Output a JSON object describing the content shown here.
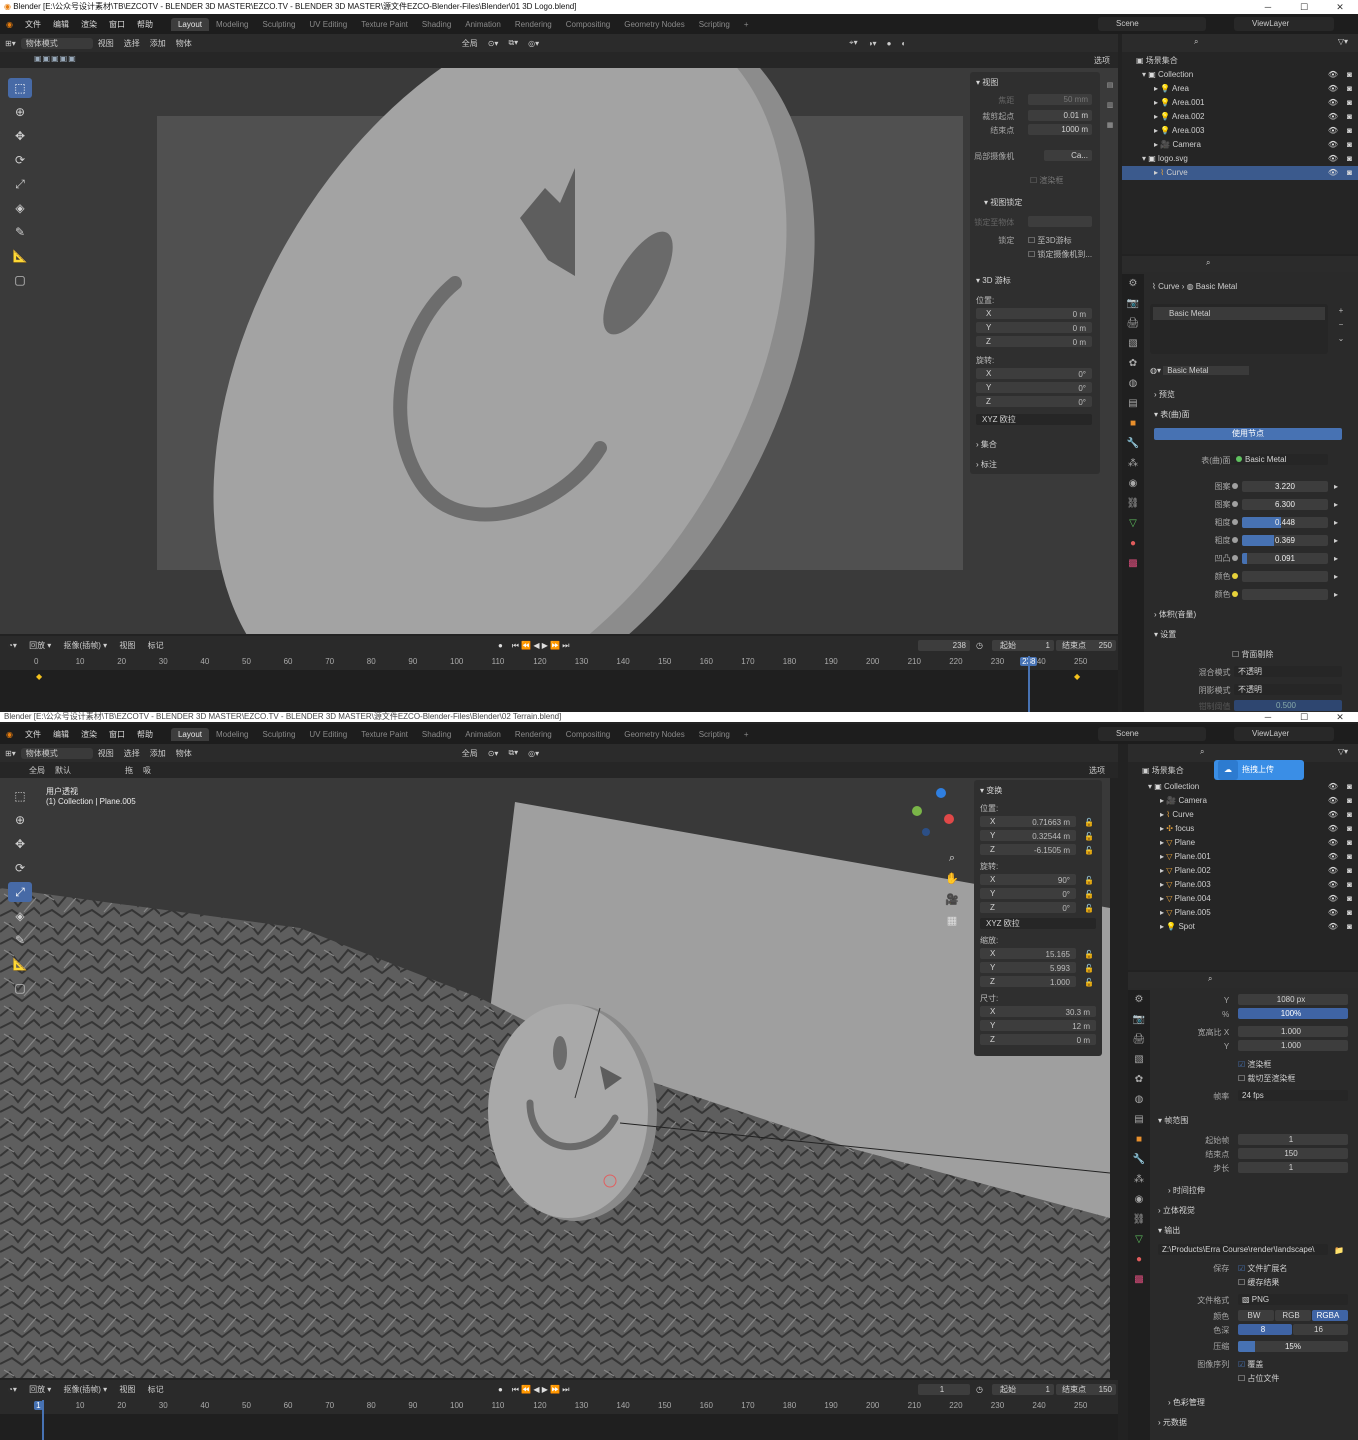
{
  "top": {
    "title": "Blender [E:\\公众号设计素材\\TB\\EZCOTV - BLENDER 3D MASTER\\EZCO.TV - BLENDER 3D MASTER\\源文件EZCO-Blender-Files\\Blender\\01 3D Logo.blend]",
    "menus": [
      "文件",
      "编辑",
      "渲染",
      "窗口",
      "帮助"
    ],
    "workspaces": [
      "Layout",
      "Modeling",
      "Sculpting",
      "UV Editing",
      "Texture Paint",
      "Shading",
      "Animation",
      "Rendering",
      "Compositing",
      "Geometry Nodes",
      "Scripting"
    ],
    "scene": "Scene",
    "view_layer": "ViewLayer",
    "mode": "物体模式",
    "view_menus": [
      "视图",
      "选择",
      "添加",
      "物体"
    ],
    "transform_orient": "全局",
    "options": "选项",
    "npanel": {
      "view_header": "视图",
      "focal_label": "焦距",
      "focal_value": "50 mm",
      "clip_start_label": "裁剪起点",
      "clip_start_value": "0.01 m",
      "clip_end_label": "结束点",
      "clip_end_value": "1000 m",
      "local_cam_label": "局部摄像机",
      "local_cam_value": "Ca...",
      "render_region": "渲染框",
      "view_lock_header": "视图锁定",
      "lock_obj_label": "锁定至物体",
      "lock_label": "锁定",
      "lock_3dcursor": "至3D游标",
      "lock_camera": "锁定摄像机到...",
      "cursor_header": "3D 游标",
      "location_label": "位置:",
      "loc": [
        {
          "axis": "X",
          "value": "0 m"
        },
        {
          "axis": "Y",
          "value": "0 m"
        },
        {
          "axis": "Z",
          "value": "0 m"
        }
      ],
      "rotation_label": "旋转:",
      "rot": [
        {
          "axis": "X",
          "value": "0°"
        },
        {
          "axis": "Y",
          "value": "0°"
        },
        {
          "axis": "Z",
          "value": "0°"
        }
      ],
      "rot_mode": "XYZ 欧拉",
      "collection_header": "集合",
      "annotation_header": "标注"
    },
    "outliner": {
      "root": "场景集合",
      "items": [
        {
          "name": "Collection",
          "indent": 1,
          "icon": "collection-icon"
        },
        {
          "name": "Area",
          "indent": 2,
          "icon": "light-icon"
        },
        {
          "name": "Area.001",
          "indent": 2,
          "icon": "light-icon"
        },
        {
          "name": "Area.002",
          "indent": 2,
          "icon": "light-icon"
        },
        {
          "name": "Area.003",
          "indent": 2,
          "icon": "light-icon"
        },
        {
          "name": "Camera",
          "indent": 2,
          "icon": "camera-icon"
        },
        {
          "name": "logo.svg",
          "indent": 1,
          "icon": "collection-icon"
        },
        {
          "name": "Curve",
          "indent": 2,
          "icon": "curve-icon",
          "selected": true
        }
      ]
    },
    "props": {
      "breadcrumb_obj": "Curve",
      "breadcrumb_mat": "Basic Metal",
      "slot": "Basic Metal",
      "material_name": "Basic Metal",
      "preview": "预览",
      "surface": "表(曲)面",
      "use_nodes": "使用节点",
      "surface_label": "表(曲)面",
      "surface_value": "Basic Metal",
      "sliders": [
        {
          "label": "图案",
          "value": "3.220",
          "fill": 0
        },
        {
          "label": "图案",
          "value": "6.300",
          "fill": 0
        },
        {
          "label": "粗度",
          "value": "0.448",
          "fill": 0.448
        },
        {
          "label": "粗度",
          "value": "0.369",
          "fill": 0.369
        },
        {
          "label": "凹凸",
          "value": "0.091",
          "fill": 0.06
        },
        {
          "label": "颜色",
          "value": "",
          "fill": 0
        },
        {
          "label": "颜色",
          "value": "",
          "fill": 0
        }
      ],
      "volume": "体积(音量)",
      "settings": "设置",
      "backface": "背面剔除",
      "blend_label": "混合模式",
      "blend_value": "不透明",
      "shadow_label": "阴影模式",
      "shadow_value": "不透明",
      "clip_label": "钳制阈值",
      "clip_value": "0.500"
    },
    "timeline": {
      "playback": "回放",
      "keying": "抠像(插帧)",
      "view": "视图",
      "marker": "标记",
      "current": "238",
      "start_label": "起始",
      "start": "1",
      "end_label": "结束点",
      "end": "250",
      "ticks": [
        "0",
        "10",
        "20",
        "30",
        "40",
        "50",
        "60",
        "70",
        "80",
        "90",
        "100",
        "110",
        "120",
        "130",
        "140",
        "150",
        "160",
        "170",
        "180",
        "190",
        "200",
        "210",
        "220",
        "230",
        "240",
        "250"
      ],
      "current_frame": 238
    }
  },
  "bottom": {
    "title": "Blender [E:\\公众号设计素材\\TB\\EZCOTV - BLENDER 3D MASTER\\EZCO.TV - BLENDER 3D MASTER\\源文件EZCO-Blender-Files\\Blender\\02 Terrain.blend]",
    "view_label": "用户透视",
    "view_sub": "(1) Collection | Plane.005",
    "header2": [
      "全局",
      "默认",
      "拖",
      "吸"
    ],
    "npanel": {
      "transform_header": "变换",
      "location_label": "位置:",
      "loc": [
        {
          "axis": "X",
          "value": "0.71663 m"
        },
        {
          "axis": "Y",
          "value": "0.32544 m"
        },
        {
          "axis": "Z",
          "value": "-6.1505 m"
        }
      ],
      "rotation_label": "旋转:",
      "rot": [
        {
          "axis": "X",
          "value": "90°"
        },
        {
          "axis": "Y",
          "value": "0°"
        },
        {
          "axis": "Z",
          "value": "0°"
        }
      ],
      "rot_mode": "XYZ 欧拉",
      "scale_label": "缩放:",
      "scale": [
        {
          "axis": "X",
          "value": "15.165"
        },
        {
          "axis": "Y",
          "value": "5.993"
        },
        {
          "axis": "Z",
          "value": "1.000"
        }
      ],
      "dims_label": "尺寸:",
      "dims": [
        {
          "axis": "X",
          "value": "30.3 m"
        },
        {
          "axis": "Y",
          "value": "12 m"
        },
        {
          "axis": "Z",
          "value": "0 m"
        }
      ]
    },
    "upload_button": "拖拽上传",
    "outliner": {
      "root": "场景集合",
      "items": [
        {
          "name": "Collection",
          "indent": 1,
          "icon": "collection-icon"
        },
        {
          "name": "Camera",
          "indent": 2,
          "icon": "camera-icon"
        },
        {
          "name": "Curve",
          "indent": 2,
          "icon": "curve-icon"
        },
        {
          "name": "focus",
          "indent": 2,
          "icon": "empty-icon"
        },
        {
          "name": "Plane",
          "indent": 2,
          "icon": "mesh-icon"
        },
        {
          "name": "Plane.001",
          "indent": 2,
          "icon": "mesh-icon"
        },
        {
          "name": "Plane.002",
          "indent": 2,
          "icon": "mesh-icon"
        },
        {
          "name": "Plane.003",
          "indent": 2,
          "icon": "mesh-icon"
        },
        {
          "name": "Plane.004",
          "indent": 2,
          "icon": "mesh-icon"
        },
        {
          "name": "Plane.005",
          "indent": 2,
          "icon": "mesh-icon"
        },
        {
          "name": "Spot",
          "indent": 2,
          "icon": "light-icon"
        }
      ]
    },
    "props": {
      "res_y_label": "Y",
      "res_y": "1080 px",
      "res_pct_label": "%",
      "res_pct": "100%",
      "aspect_x_label": "宽高比 X",
      "aspect_x": "1.000",
      "aspect_y_label": "Y",
      "aspect_y": "1.000",
      "render_region": "渲染框",
      "crop": "裁切至渲染框",
      "fps_label": "帧率",
      "fps": "24 fps",
      "frame_range": "帧范围",
      "frame_start_label": "起始帧",
      "frame_start": "1",
      "frame_end_label": "结束点",
      "frame_end": "150",
      "frame_step_label": "步长",
      "frame_step": "1",
      "time_stretch": "时间拉伸",
      "stereoscopy": "立体视觉",
      "output": "输出",
      "output_path": "Z:\\Products\\Erra Course\\render\\landscape\\",
      "saving_label": "保存",
      "file_ext": "文件扩展名",
      "cache": "缓存结果",
      "format_label": "文件格式",
      "format": "PNG",
      "color_label": "颜色",
      "color_opts": [
        "BW",
        "RGB",
        "RGBA"
      ],
      "depth_label": "色深",
      "depth_opts": [
        "8",
        "16"
      ],
      "compress_label": "压缩",
      "compress": "15%",
      "seq_label": "图像序列",
      "overwrite": "覆盖",
      "placeholder": "占位文件",
      "color_mgmt": "色彩管理",
      "metadata": "元数据"
    },
    "timeline": {
      "playback": "回放",
      "keying": "抠像(插帧)",
      "view": "视图",
      "marker": "标记",
      "current": "1",
      "start_label": "起始",
      "start": "1",
      "end_label": "结束点",
      "end": "150",
      "ticks": [
        "1",
        "10",
        "20",
        "30",
        "40",
        "50",
        "60",
        "70",
        "80",
        "90",
        "100",
        "110",
        "120",
        "130",
        "140",
        "150",
        "160",
        "170",
        "180",
        "190",
        "200",
        "210",
        "220",
        "230",
        "240",
        "250"
      ],
      "current_frame": 1
    }
  }
}
